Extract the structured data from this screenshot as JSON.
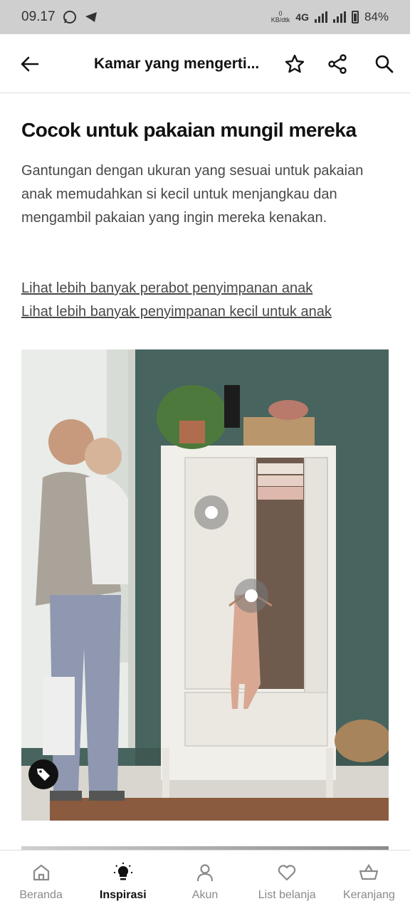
{
  "status_bar": {
    "time": "09.17",
    "net_speed_value": "0",
    "net_speed_unit": "KB/dtk",
    "network_type": "4G",
    "battery": "84%"
  },
  "header": {
    "title": "Kamar yang mengerti..."
  },
  "section": {
    "title": "Cocok untuk pakaian mungil mereka",
    "description": "Gantungan dengan ukuran yang sesuai untuk pakaian anak memudahkan si kecil untuk menjangkau dan mengambil pakaian yang ingin mereka kenakan.",
    "links": [
      "Lihat lebih banyak perabot penyimpanan anak",
      "Lihat lebih banyak penyimpanan kecil untuk anak"
    ]
  },
  "bottom_nav": {
    "items": [
      {
        "label": "Beranda",
        "icon": "home-icon",
        "active": false
      },
      {
        "label": "Inspirasi",
        "icon": "lightbulb-icon",
        "active": true
      },
      {
        "label": "Akun",
        "icon": "person-icon",
        "active": false
      },
      {
        "label": "List belanja",
        "icon": "heart-icon",
        "active": false
      },
      {
        "label": "Keranjang",
        "icon": "basket-icon",
        "active": false
      }
    ]
  },
  "colors": {
    "accent": "#111111",
    "muted": "#8a8a8a",
    "body_text": "#484848"
  }
}
